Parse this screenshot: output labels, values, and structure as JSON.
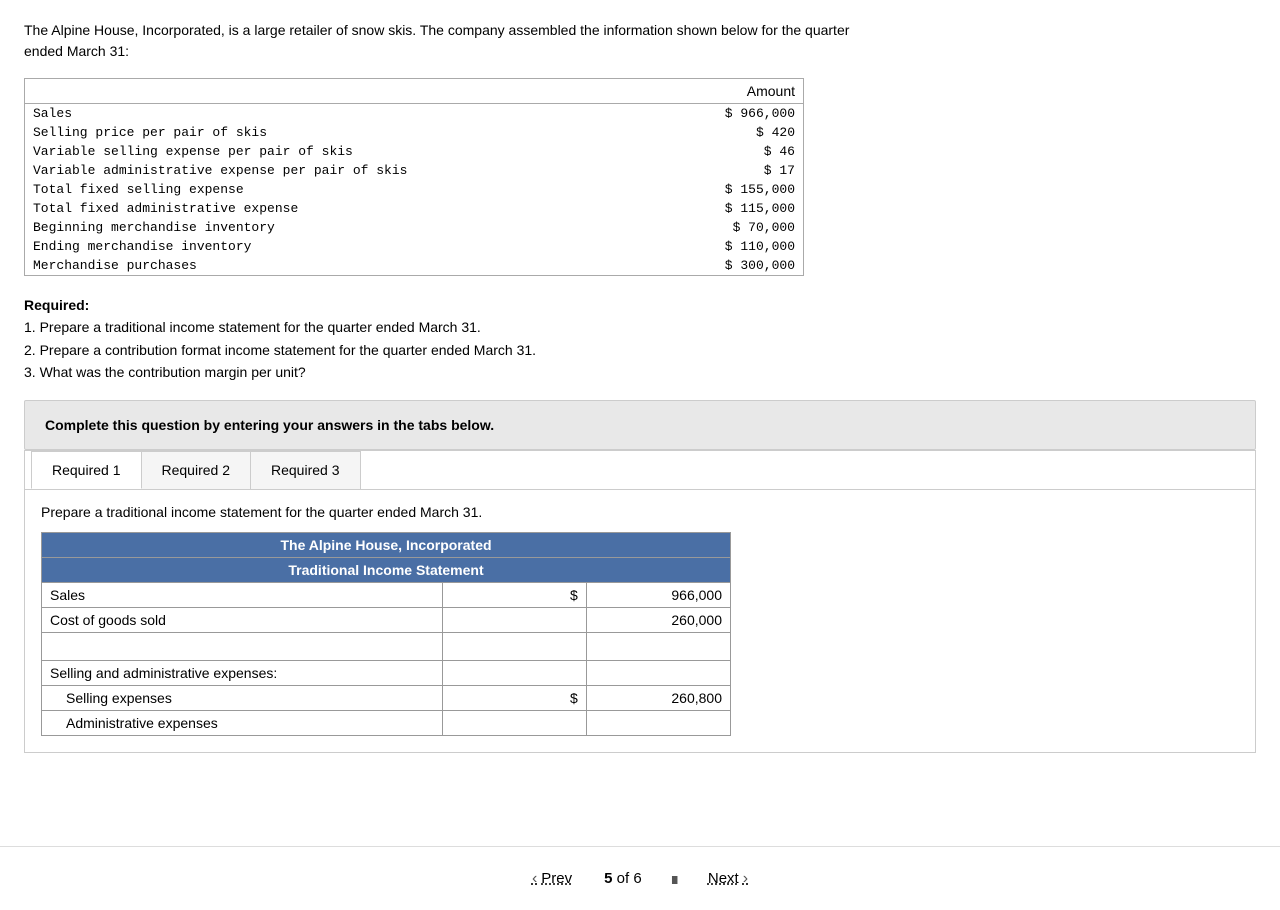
{
  "intro": {
    "text1": "The Alpine House, Incorporated, is a large retailer of snow skis. The company assembled the information shown below for the quarter",
    "text2": "ended March 31:"
  },
  "data_table": {
    "header": "Amount",
    "rows": [
      {
        "label": "Sales",
        "amount": "$ 966,000"
      },
      {
        "label": "Selling price per pair of skis",
        "amount": "$ 420"
      },
      {
        "label": "Variable selling expense per pair of skis",
        "amount": "$ 46"
      },
      {
        "label": "Variable administrative expense per pair of skis",
        "amount": "$ 17"
      },
      {
        "label": "Total fixed selling expense",
        "amount": "$ 155,000"
      },
      {
        "label": "Total fixed administrative expense",
        "amount": "$ 115,000"
      },
      {
        "label": "Beginning merchandise inventory",
        "amount": "$ 70,000"
      },
      {
        "label": "Ending merchandise inventory",
        "amount": "$ 110,000"
      },
      {
        "label": "Merchandise purchases",
        "amount": "$ 300,000"
      }
    ]
  },
  "required_section": {
    "title": "Required:",
    "items": [
      "1. Prepare a traditional income statement for the quarter ended March 31.",
      "2. Prepare a contribution format income statement for the quarter ended March 31.",
      "3. What was the contribution margin per unit?"
    ]
  },
  "complete_box": {
    "text": "Complete this question by entering your answers in the tabs below."
  },
  "tabs": {
    "items": [
      {
        "id": "req1",
        "label": "Required 1",
        "active": true
      },
      {
        "id": "req2",
        "label": "Required 2",
        "active": false
      },
      {
        "id": "req3",
        "label": "Required 3",
        "active": false
      }
    ]
  },
  "tab_content": {
    "description": "Prepare a traditional income statement for the quarter ended March 31.",
    "income_statement": {
      "company": "The Alpine House, Incorporated",
      "title": "Traditional Income Statement",
      "rows": [
        {
          "label": "Sales",
          "col1": "$",
          "col2": "966,000",
          "indent": false
        },
        {
          "label": "Cost of goods sold",
          "col1": "",
          "col2": "260,000",
          "indent": false
        },
        {
          "label": "",
          "col1": "",
          "col2": "",
          "indent": false,
          "empty": true
        },
        {
          "label": "Selling and administrative expenses:",
          "col1": "",
          "col2": "",
          "indent": false
        },
        {
          "label": "Selling expenses",
          "col1": "$",
          "col2": "260,800",
          "indent": true
        },
        {
          "label": "Administrative expenses",
          "col1": "",
          "col2": "",
          "indent": true
        }
      ]
    }
  },
  "pagination": {
    "prev_label": "Prev",
    "next_label": "Next",
    "current_page": "5",
    "total_pages": "6"
  }
}
